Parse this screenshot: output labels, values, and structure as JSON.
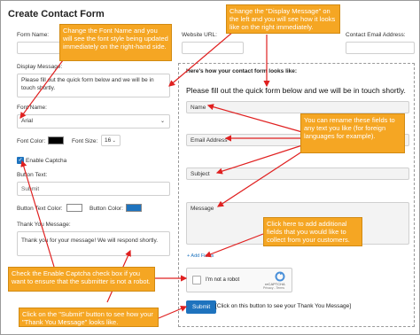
{
  "form": {
    "title": "Create Contact Form",
    "labels": {
      "form_name": "Form Name:",
      "website_url": "Website URL:",
      "contact_email": "Contact Email Address:",
      "display_message": "Display Message:",
      "font_name": "Font Name:",
      "font_color": "Font Color:",
      "font_size": "Font Size:",
      "enable_captcha": "Enable Captcha",
      "button_text": "Button Text:",
      "button_text_color": "Button Text Color:",
      "button_color": "Button Color:",
      "thank_you": "Thank You Message:"
    },
    "display_message_value": "Please fill out the quick form below and we will be in touch shortly.",
    "font_name_value": "Arial",
    "font_size_value": "16",
    "font_color": "#000000",
    "button_text_color": "#ffffff",
    "button_color": "#1e73be",
    "captcha_checked": true,
    "button_text_placeholder": "Submit",
    "thank_you_value": "Thank you for your message! We will respond shortly."
  },
  "preview": {
    "heading": "Here's how your contact form looks like:",
    "message": "Please fill out the quick form below and we will be in touch shortly.",
    "fields": [
      "Name",
      "Email Address",
      "Subject",
      "Message"
    ],
    "add_fields": "+ Add Fields",
    "captcha_label": "I'm not a robot",
    "captcha_brand": "reCAPTCHA",
    "captcha_terms": "Privacy - Terms",
    "submit_label": "Submit",
    "submit_note": "[Click on this button to see your Thank You Message]"
  },
  "callouts": {
    "font_name": "Change the Font Name and you will see the font style being updated immediately on the right-hand side.",
    "display_message": "Change the \"Display Message\" on the left and you will see how it looks like on the right immediately.",
    "rename_fields": "You can rename these fields to any text you like (for foreign languages for example).",
    "add_fields": "Click here to add additional fields that you would like to collect from your customers.",
    "captcha": "Check the Enable Captcha check box if you want to ensure that the submitter is not a robot.",
    "submit": "Click on the \"Submit\" button to see how your \"Thank You Message\" looks like."
  },
  "colors": {
    "accent_orange": "#f5a623",
    "arrow_red": "#e02020",
    "primary_blue": "#1e73be"
  }
}
